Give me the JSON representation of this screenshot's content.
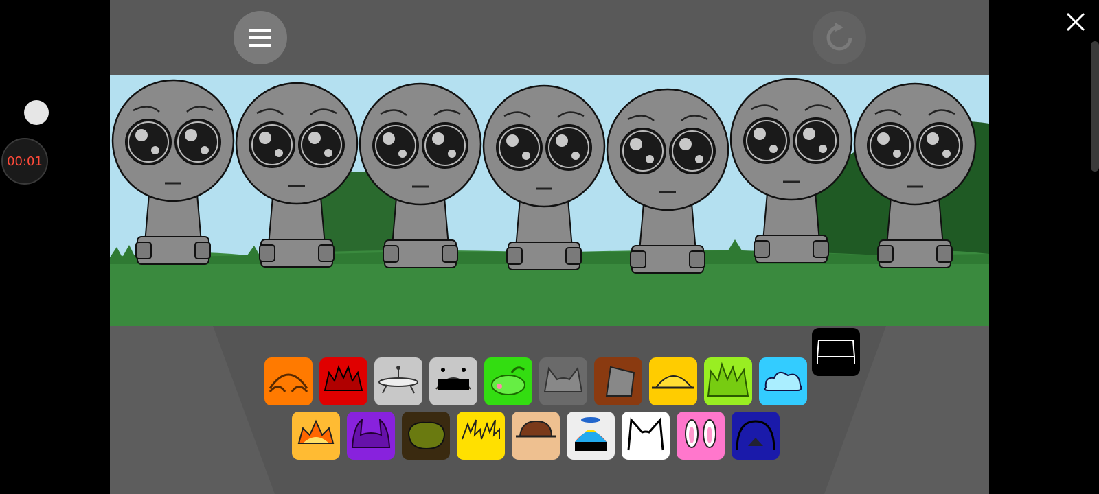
{
  "recorder": {
    "timer": "00:01"
  },
  "toolbar": {
    "menu_icon": "hamburger-menu-icon",
    "reset_icon": "refresh-icon",
    "close_icon": "close-icon"
  },
  "scene": {
    "sky_color": "#b4e0f0",
    "grass_color": "#3a8a3e",
    "hill_color": "#1f5a24",
    "character_color": "#8a8a8a",
    "character_count": 7
  },
  "palette": {
    "row1": [
      {
        "name": "orange-headphones",
        "color": "#ff7a00"
      },
      {
        "name": "red-spiky",
        "color": "#e00000"
      },
      {
        "name": "silver-ufo",
        "color": "#c8c8c8"
      },
      {
        "name": "robot-visor",
        "color": "#c8c8c8"
      },
      {
        "name": "green-leaf",
        "color": "#33dd11"
      },
      {
        "name": "gray-cat-ears",
        "color": "#6a6a6a"
      },
      {
        "name": "brown-bucket",
        "color": "#8a3a10"
      },
      {
        "name": "yellow-helmet",
        "color": "#ffcc00"
      },
      {
        "name": "lime-spiky",
        "color": "#99ee22"
      },
      {
        "name": "cyan-cloud",
        "color": "#33ccff"
      },
      {
        "name": "black-frame",
        "color": "#000000"
      }
    ],
    "row2": [
      {
        "name": "yellow-crown",
        "color": "#ffbb33"
      },
      {
        "name": "purple-horns",
        "color": "#8822dd"
      },
      {
        "name": "olive-blob",
        "color": "#3a2a10"
      },
      {
        "name": "yellow-lightning",
        "color": "#ffe000"
      },
      {
        "name": "tan-cap",
        "color": "#eec090"
      },
      {
        "name": "propeller-hat",
        "color": "#eeeeee"
      },
      {
        "name": "white-cat-ears",
        "color": "#ffffff"
      },
      {
        "name": "pink-bunny-ears",
        "color": "#ff77cc"
      },
      {
        "name": "navy-dome",
        "color": "#1a1aaa"
      }
    ]
  }
}
